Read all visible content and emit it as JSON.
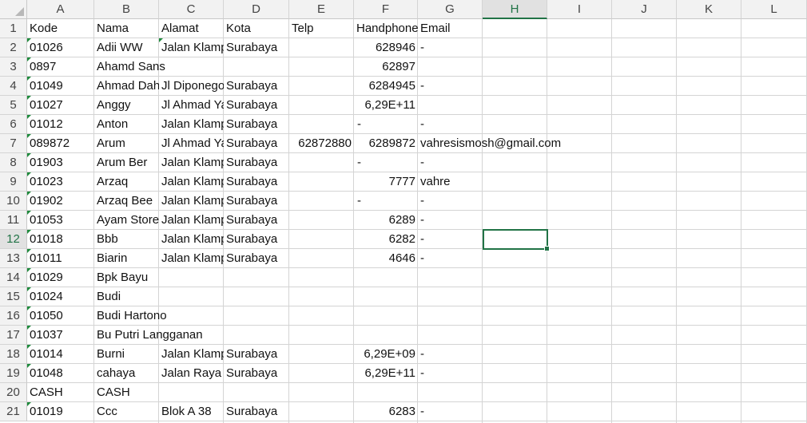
{
  "columns": [
    "A",
    "B",
    "C",
    "D",
    "E",
    "F",
    "G",
    "H",
    "I",
    "J",
    "K",
    "L"
  ],
  "active_column": "H",
  "active_row": "12",
  "row_numbers": [
    "1",
    "2",
    "3",
    "4",
    "5",
    "6",
    "7",
    "8",
    "9",
    "10",
    "11",
    "12",
    "13",
    "14",
    "15",
    "16",
    "17",
    "18",
    "19",
    "20",
    "21"
  ],
  "rows": [
    {
      "A": "Kode",
      "B": "Nama",
      "C": "Alamat",
      "D": "Kota",
      "E": "Telp",
      "F": "Handphone",
      "G": "Email"
    },
    {
      "A": "01026",
      "B": "Adii WW",
      "C": "Jalan Klampis",
      "D": "Surabaya",
      "E": "",
      "F": "628946",
      "G": "-"
    },
    {
      "A": "0897",
      "B": "Ahamd Sans",
      "C": "",
      "D": "",
      "E": "",
      "F": "62897",
      "G": ""
    },
    {
      "A": "01049",
      "B": "Ahmad Dahlan",
      "C": "Jl Diponegoro",
      "D": "Surabaya",
      "E": "",
      "F": "6284945",
      "G": "-"
    },
    {
      "A": "01027",
      "B": "Anggy",
      "C": "Jl Ahmad Yani",
      "D": "Surabaya",
      "E": "",
      "F": "6,29E+11",
      "G": ""
    },
    {
      "A": "01012",
      "B": "Anton",
      "C": "Jalan Klampis",
      "D": "Surabaya",
      "E": "",
      "F": "-",
      "G": "-"
    },
    {
      "A": "089872",
      "B": "Arum",
      "C": "Jl Ahmad Yani",
      "D": "Surabaya",
      "E": "62872880",
      "F": "6289872",
      "G": "vahresismosh@gmail.com"
    },
    {
      "A": "01903",
      "B": "Arum Ber",
      "C": "Jalan Klampis",
      "D": "Surabaya",
      "E": "",
      "F": "-",
      "G": "-"
    },
    {
      "A": "01023",
      "B": "Arzaq",
      "C": "Jalan Klampis",
      "D": "Surabaya",
      "E": "",
      "F": "7777",
      "G": "vahre"
    },
    {
      "A": "01902",
      "B": "Arzaq Bee",
      "C": "Jalan Klampis",
      "D": "Surabaya",
      "E": "",
      "F": "-",
      "G": "-"
    },
    {
      "A": "01053",
      "B": "Ayam Store",
      "C": "Jalan Klampis",
      "D": "Surabaya",
      "E": "",
      "F": "6289",
      "G": "-"
    },
    {
      "A": "01018",
      "B": "Bbb",
      "C": "Jalan Klampis",
      "D": "Surabaya",
      "E": "",
      "F": "6282",
      "G": "-"
    },
    {
      "A": "01011",
      "B": "Biarin",
      "C": "Jalan Klampis",
      "D": "Surabaya",
      "E": "",
      "F": "4646",
      "G": "-"
    },
    {
      "A": "01029",
      "B": "Bpk Bayu",
      "C": "",
      "D": "",
      "E": "",
      "F": "",
      "G": ""
    },
    {
      "A": "01024",
      "B": "Budi",
      "C": "",
      "D": "",
      "E": "",
      "F": "",
      "G": ""
    },
    {
      "A": "01050",
      "B": "Budi Hartono",
      "C": "",
      "D": "",
      "E": "",
      "F": "",
      "G": ""
    },
    {
      "A": "01037",
      "B": "Bu Putri Langganan",
      "C": "",
      "D": "",
      "E": "",
      "F": "",
      "G": ""
    },
    {
      "A": "01014",
      "B": "Burni",
      "C": "Jalan Klampis",
      "D": "Surabaya",
      "E": "",
      "F": "6,29E+09",
      "G": "-"
    },
    {
      "A": "01048",
      "B": "cahaya",
      "C": "Jalan Raya",
      "D": "Surabaya",
      "E": "",
      "F": "6,29E+11",
      "G": "-"
    },
    {
      "A": "CASH",
      "B": "CASH",
      "C": "",
      "D": "",
      "E": "",
      "F": "",
      "G": ""
    },
    {
      "A": "01019",
      "B": "Ccc",
      "C": "Blok A 38",
      "D": "Surabaya",
      "E": "",
      "F": "6283",
      "G": "-"
    }
  ],
  "colors": {
    "accent": "#217346",
    "gridline": "#d4d4d4",
    "header_bg": "#f2f2f2"
  }
}
